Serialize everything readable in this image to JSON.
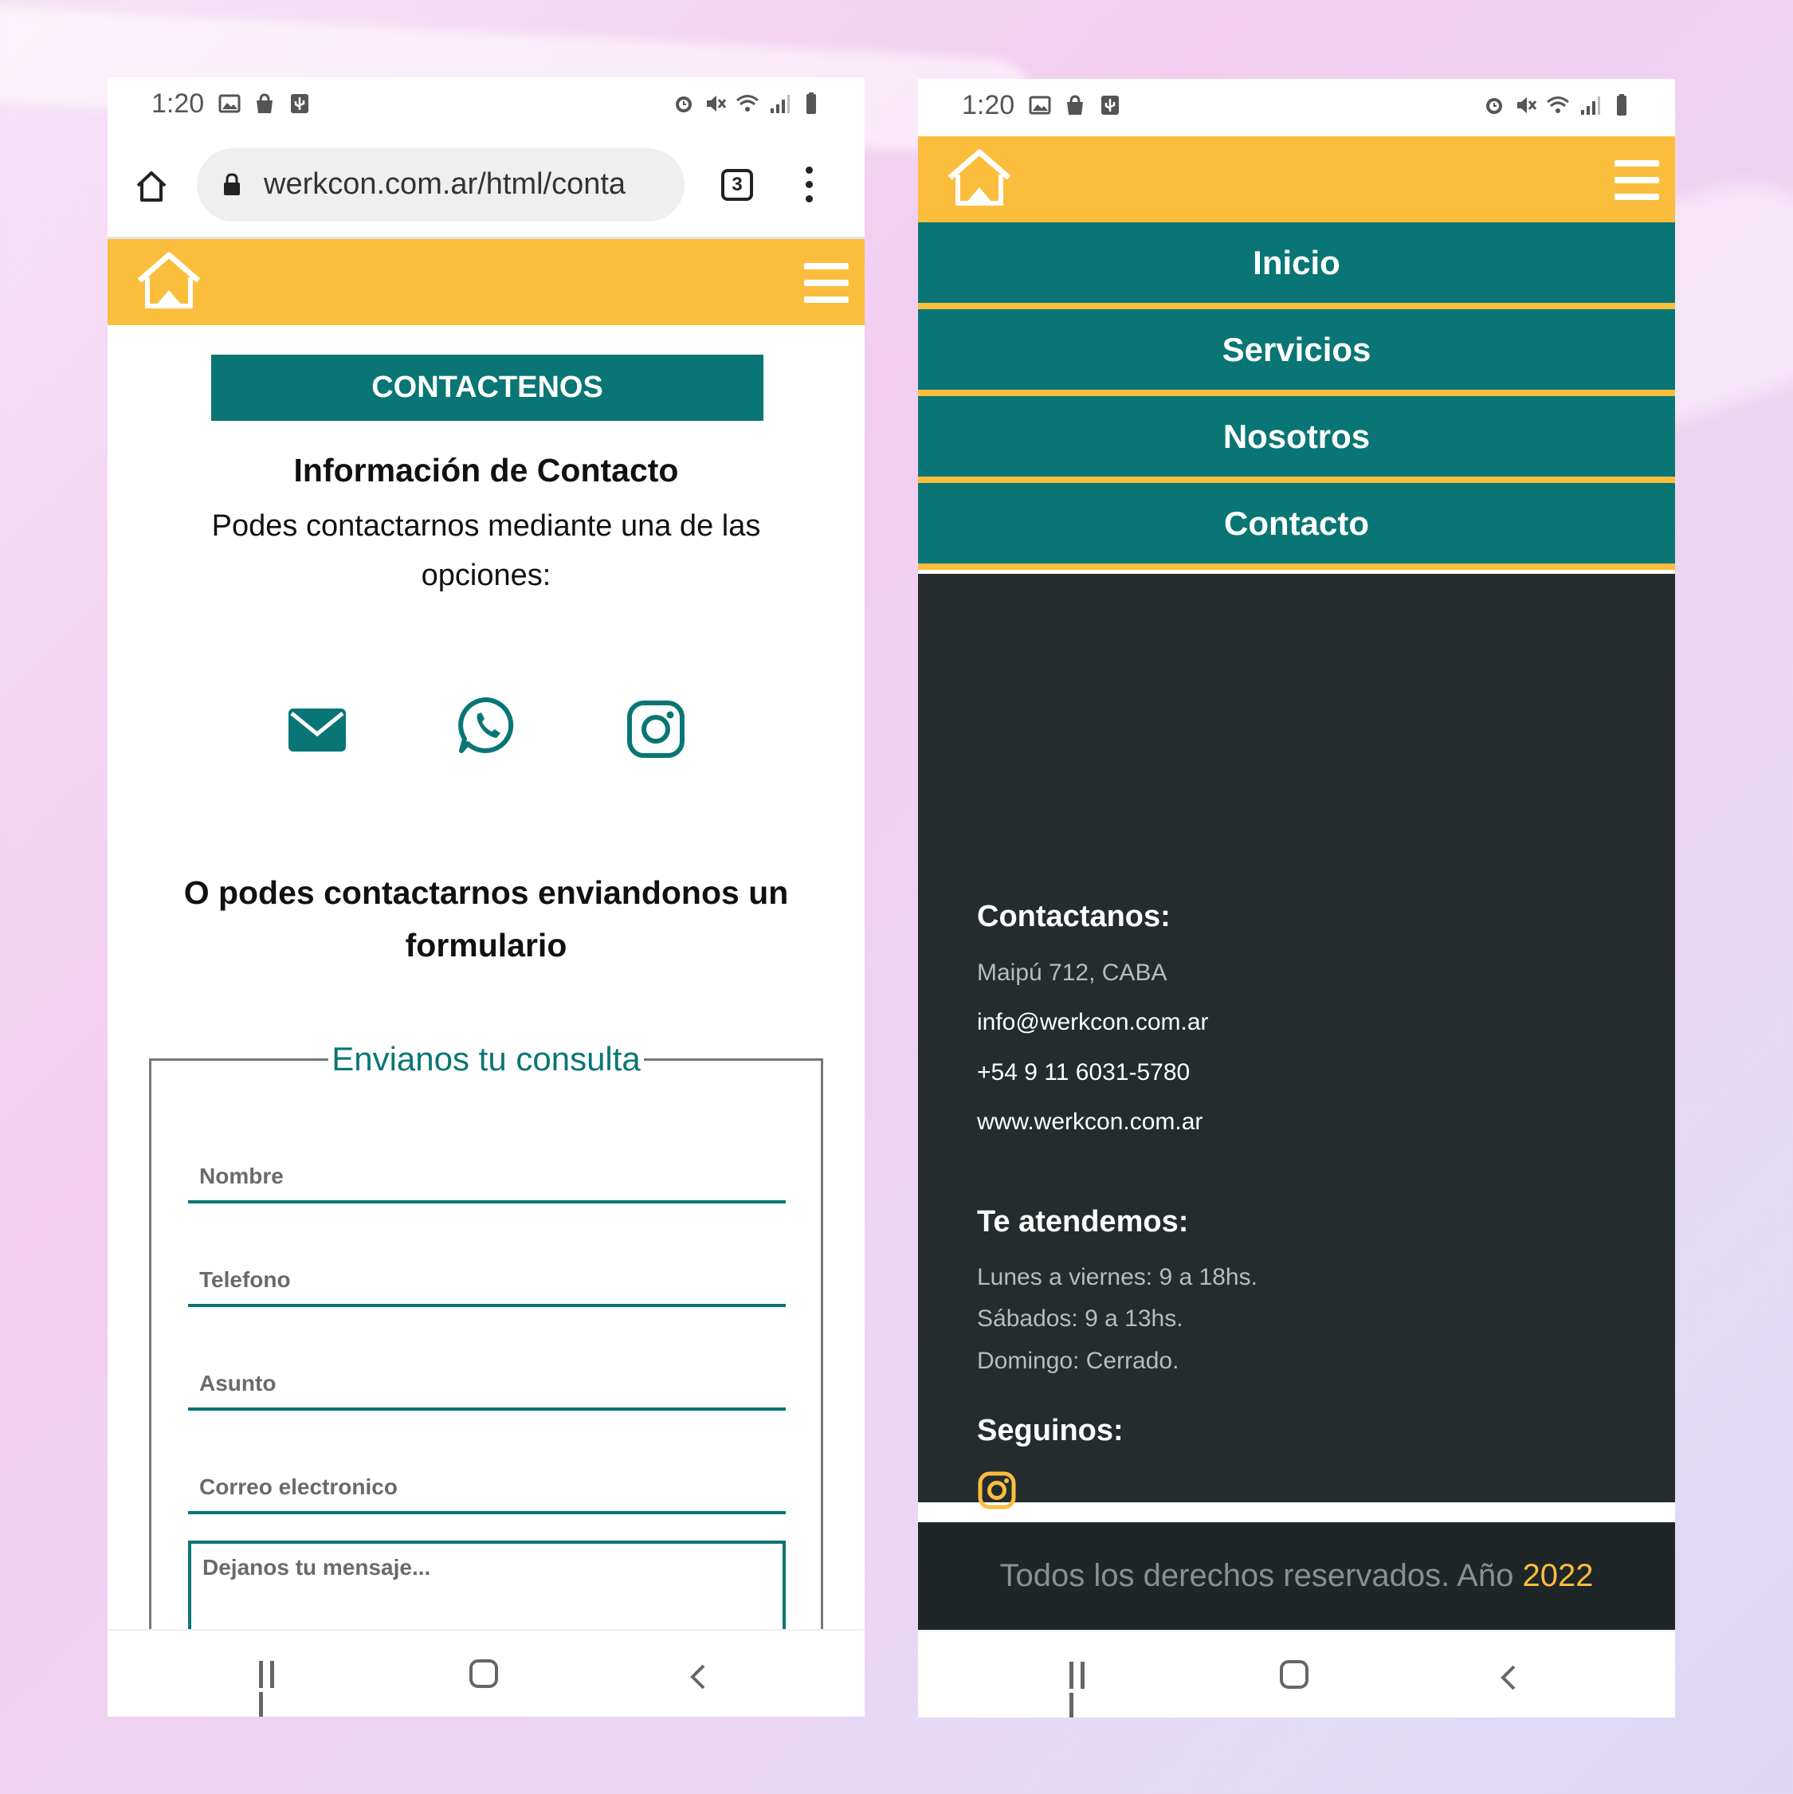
{
  "left_screen": {
    "status": {
      "time": "1:20"
    },
    "browser": {
      "url": "werkcon.com.ar/html/conta",
      "tab_count": "3"
    },
    "banner": "CONTACTENOS",
    "info_title": "Información de Contacto",
    "info_text": "Podes contactarnos mediante una de las opciones:",
    "form_title": "O podes contactarnos enviandonos un formulario",
    "form": {
      "legend": "Envianos tu consulta",
      "fields": [
        "Nombre",
        "Telefono",
        "Asunto",
        "Correo electronico"
      ],
      "message_placeholder": "Dejanos tu mensaje..."
    }
  },
  "right_screen": {
    "status": {
      "time": "1:20"
    },
    "menu": [
      "Inicio",
      "Servicios",
      "Nosotros",
      "Contacto"
    ],
    "footer": {
      "contact_heading": "Contactanos:",
      "address": "Maipú 712, CABA",
      "email": "info@werkcon.com.ar",
      "phone": "+54 9 11 6031-5780",
      "website": "www.werkcon.com.ar",
      "hours_heading": "Te atendemos:",
      "hours": [
        "Lunes a viernes: 9 a 18hs.",
        "Sábados: 9 a 13hs.",
        "Domingo: Cerrado."
      ],
      "follow_heading": "Seguinos:",
      "copyright": "Todos los derechos reservados. Año ",
      "year": "2022"
    }
  },
  "colors": {
    "brand_yellow": "#fbbd3c",
    "brand_teal": "#097675",
    "footer_dark": "#242c2e"
  },
  "icons": [
    "home-icon",
    "lock-icon",
    "menu-icon",
    "email-icon",
    "whatsapp-icon",
    "instagram-icon"
  ]
}
